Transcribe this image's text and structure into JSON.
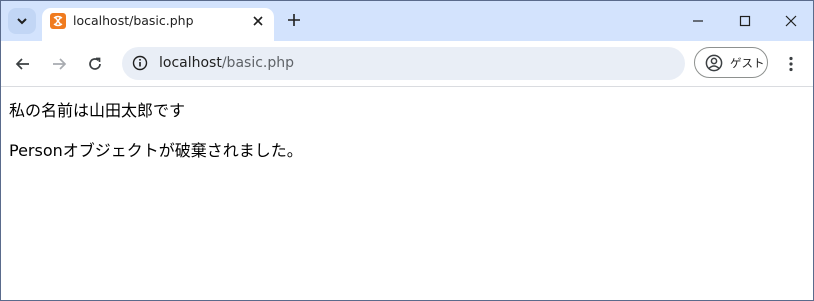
{
  "browser": {
    "tab": {
      "title": "localhost/basic.php",
      "favicon": "xampp-icon",
      "favicon_color": "#f07b1f"
    },
    "tabstrip_color": "#d3e3fd",
    "address": {
      "host": "localhost",
      "path": "/basic.php"
    },
    "profile": {
      "label": "ゲスト"
    }
  },
  "page": {
    "lines": [
      "私の名前は山田太郎です",
      "Personオブジェクトが破棄されました。"
    ]
  }
}
